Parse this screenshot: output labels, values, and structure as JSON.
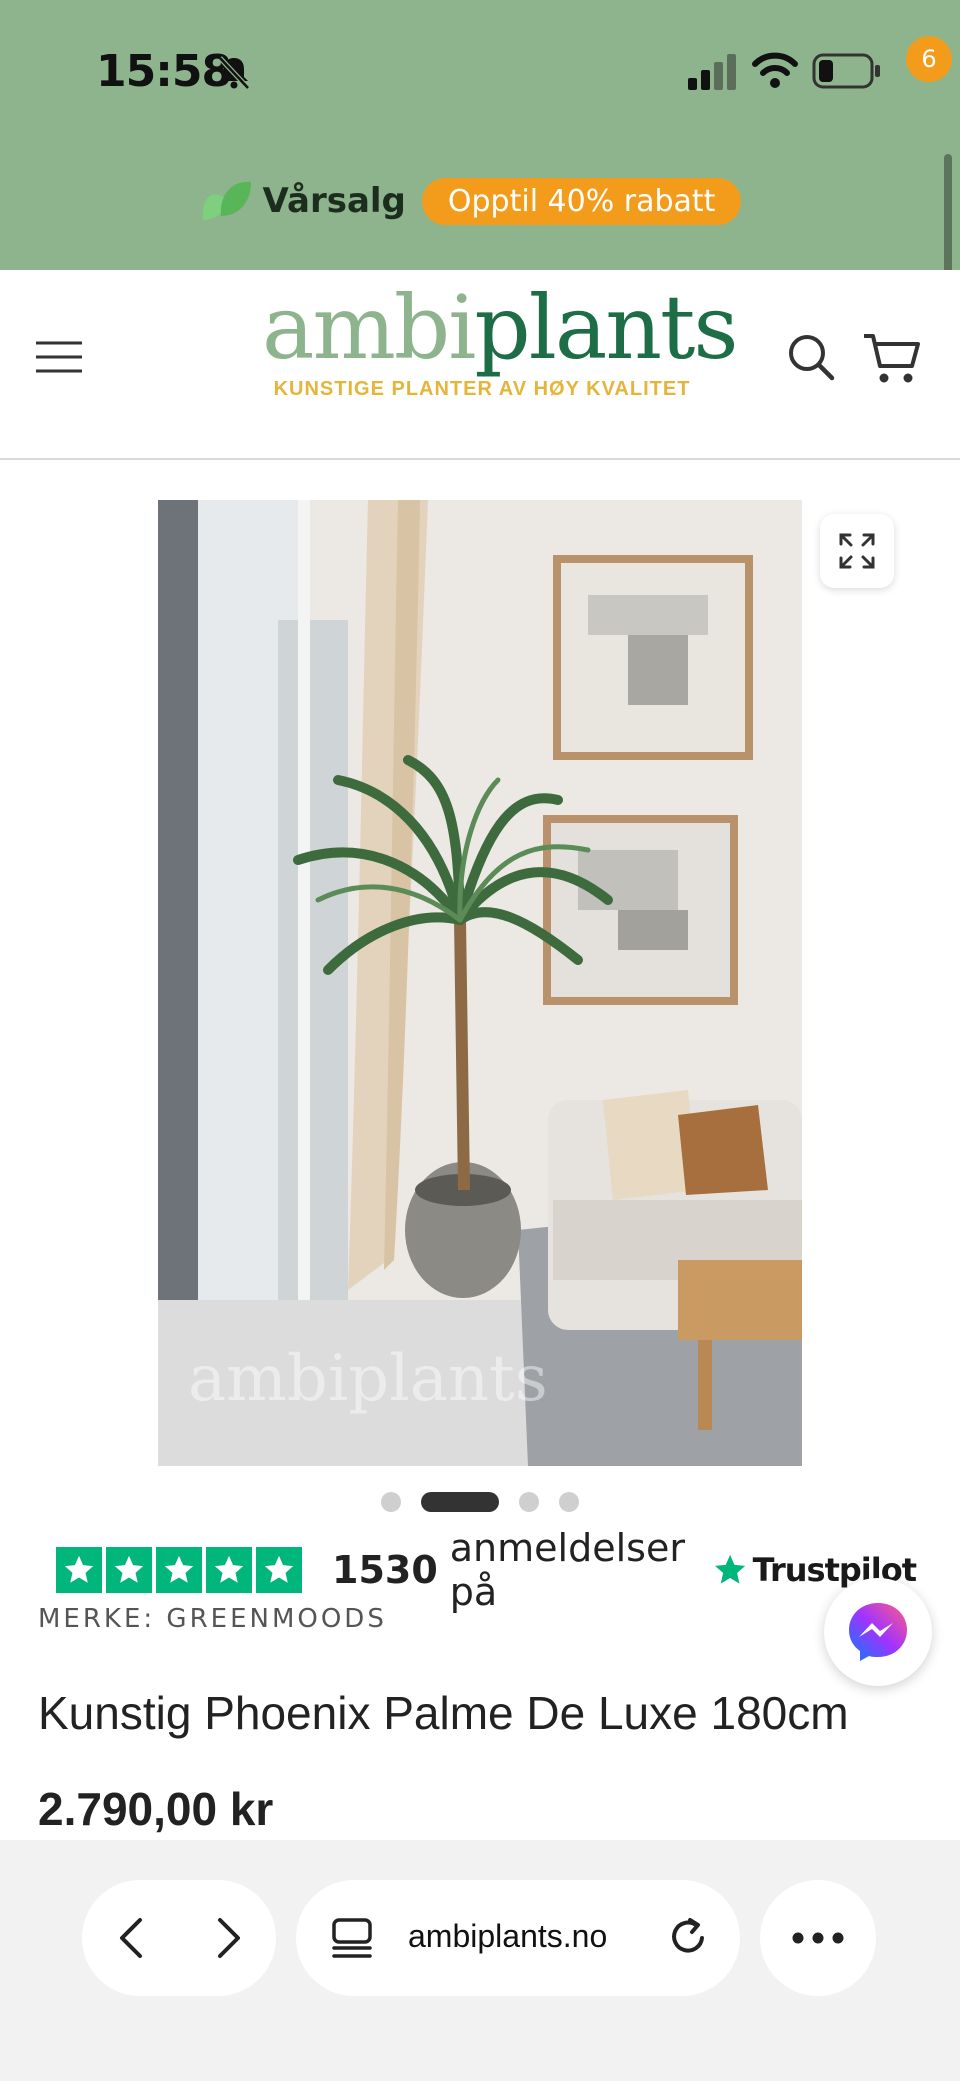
{
  "status_bar": {
    "time": "15:58"
  },
  "promo": {
    "label": "Vårsalg",
    "badge": "Opptil 40% rabatt"
  },
  "header": {
    "logo_part1": "ambi",
    "logo_part2": "plants",
    "tagline": "KUNSTIGE PLANTER AV HØY KVALITET",
    "cart_count": "6"
  },
  "gallery": {
    "watermark": "ambiplants",
    "total_images": 4,
    "active_index": 1
  },
  "trustpilot": {
    "count": "1530",
    "text": "anmeldelser på",
    "brand": "Trustpilot",
    "stars": 5
  },
  "product": {
    "brand": "MERKE: GREENMOODS",
    "title": "Kunstig Phoenix Palme De Luxe 180cm",
    "price": "2.790,00 kr"
  },
  "browser": {
    "url": "ambiplants.no"
  },
  "colors": {
    "promo_green": "#8db48d",
    "accent_orange": "#f39c1c",
    "logo_dark_green": "#1d6e46",
    "tagline_gold": "#e5b53a",
    "trustpilot_green": "#00b67a"
  }
}
